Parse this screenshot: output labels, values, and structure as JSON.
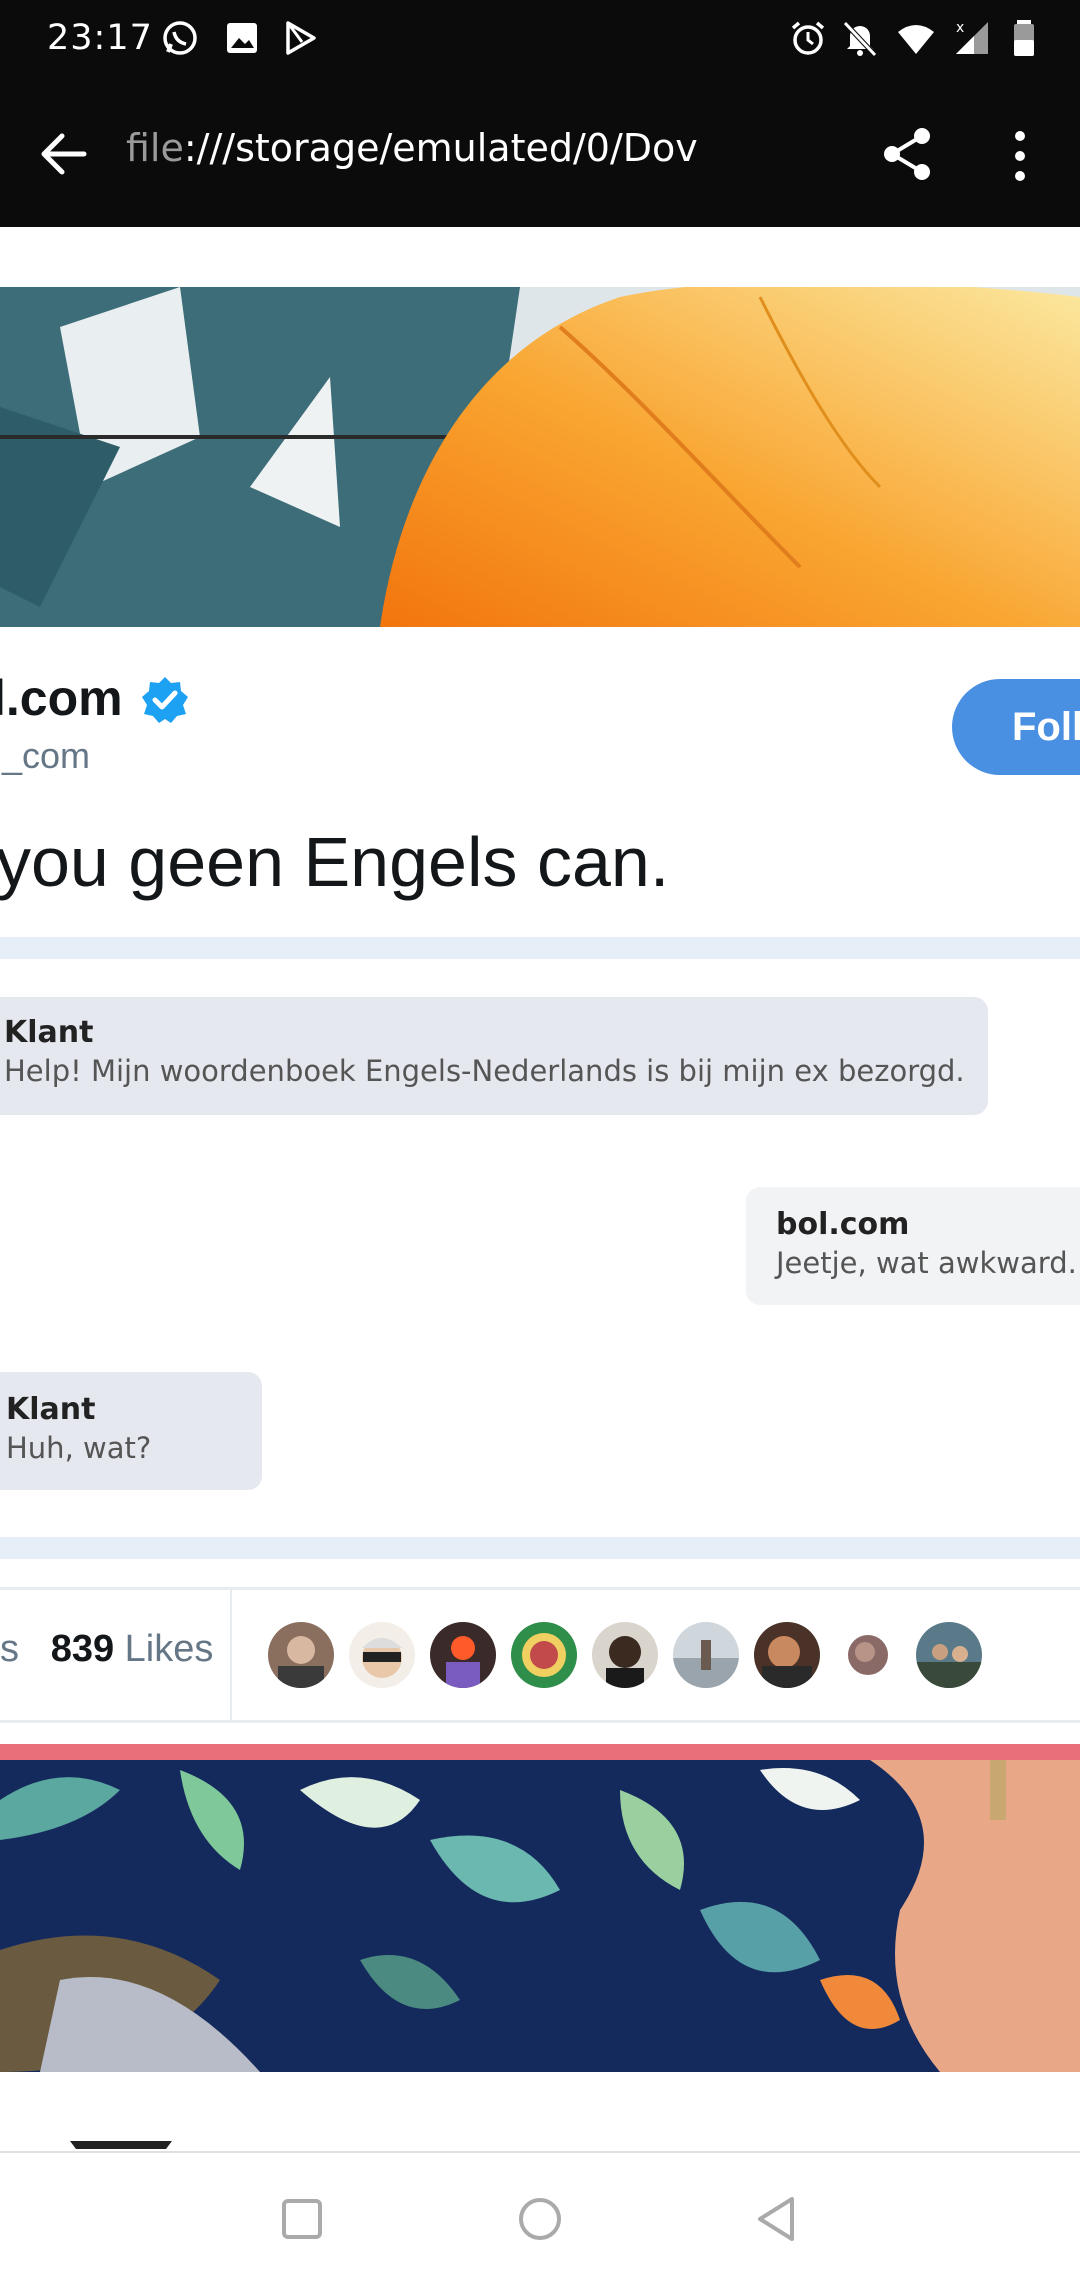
{
  "status_bar": {
    "time": "23:17",
    "left_icons": [
      "whatsapp-icon",
      "gallery-icon",
      "play-store-icon"
    ],
    "right_icons": [
      "alarm-icon",
      "notifications-off-icon",
      "wifi-icon",
      "signal-icon",
      "battery-icon"
    ]
  },
  "toolbar": {
    "url_scheme": "file",
    "url_rest": ":///storage/emulated/0/Dov",
    "back_icon": "back-arrow-icon",
    "share_icon": "share-icon",
    "menu_icon": "more-vert-icon"
  },
  "tweet": {
    "account_name": "l.com",
    "account_handle": "l_com",
    "follow_label": "Foll",
    "text": "you geen Engels can."
  },
  "chat": {
    "messages": [
      {
        "sender": "Klant",
        "text": "Help! Mijn woordenboek Engels-Nederlands is bij mijn ex bezorgd."
      },
      {
        "sender": "bol.com",
        "text": "Jeetje, wat awkward."
      },
      {
        "sender": "Klant",
        "text": "Huh, wat?"
      }
    ]
  },
  "stats": {
    "likes_count": "839",
    "likes_label": "Likes",
    "prefix": "s"
  },
  "colors": {
    "accent_blue": "#4a90e2",
    "verified_blue": "#1da1f2",
    "pink_rule": "#e9707a"
  },
  "nav": {
    "icons": [
      "recents-icon",
      "home-icon",
      "back-icon"
    ]
  }
}
